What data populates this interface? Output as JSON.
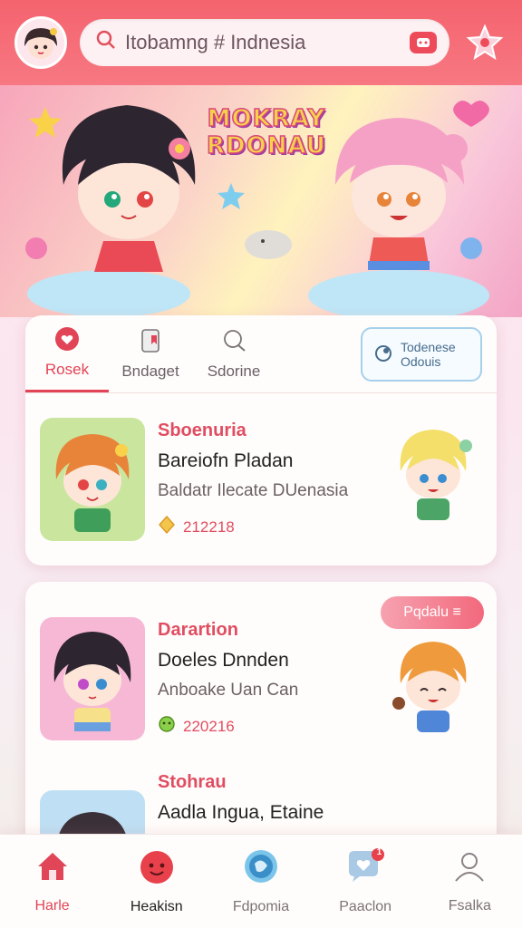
{
  "header": {
    "search_value": "Itobamng # Indnesia",
    "colors": {
      "bar": "#f4636e",
      "accent": "#e04d62"
    }
  },
  "hero": {
    "title_line1": "MOKRAY",
    "title_line2": "RDONAU"
  },
  "tabs": [
    {
      "label": "Rosek",
      "icon": "heart-chat-icon",
      "active": true
    },
    {
      "label": "Bndaget",
      "icon": "bookmark-icon",
      "active": false
    },
    {
      "label": "Sdorine",
      "icon": "search-bubble-icon",
      "active": false
    }
  ],
  "tab_badge": {
    "line1": "Todenese",
    "line2": "Odouis"
  },
  "items": [
    {
      "category": "Sboenuria",
      "title": "Bareiofn Pladan",
      "subtitle": "Baldatr Ilecate DUenasia",
      "meta": "212218",
      "meta_icon": "gold-diamond-icon"
    },
    {
      "category": "Darartion",
      "title": "Doeles Dnnden",
      "subtitle": "Anboake Uan Can",
      "meta": "220216",
      "meta_icon": "green-badge-icon",
      "pill": "Pqdalu ≡"
    },
    {
      "category": "Stohrau",
      "title": "Aadla Ingua, Etaine"
    }
  ],
  "nav": [
    {
      "label": "Harle",
      "icon": "home-icon",
      "active": true
    },
    {
      "label": "Heakisn",
      "icon": "smile-icon",
      "active": false
    },
    {
      "label": "Fdpomia",
      "icon": "globe-icon",
      "active": false
    },
    {
      "label": "Paaclon",
      "icon": "chat-heart-icon",
      "active": false,
      "badge": "1"
    },
    {
      "label": "Fsalka",
      "icon": "profile-icon",
      "active": false
    }
  ]
}
